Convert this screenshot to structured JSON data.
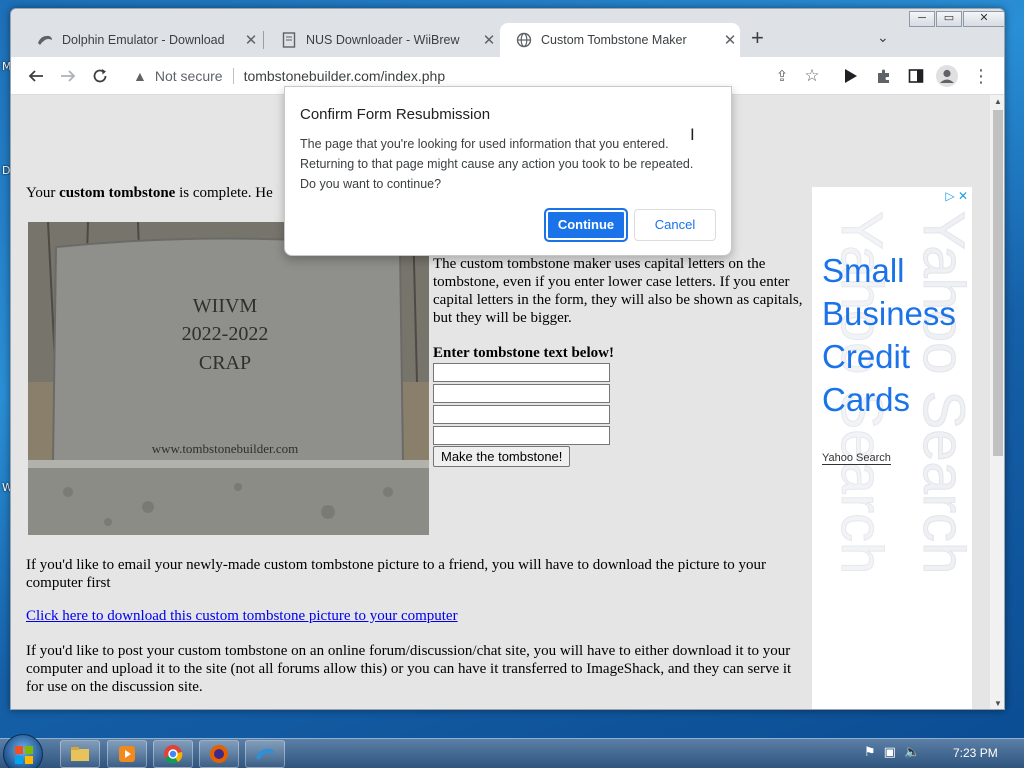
{
  "desktop": {
    "edge_labels": [
      "M",
      "D",
      "W"
    ]
  },
  "window": {
    "controls": [
      "minimize",
      "restore",
      "close"
    ]
  },
  "tabs": [
    {
      "title": "Dolphin Emulator - Download",
      "icon": "dolphin-icon",
      "active": false
    },
    {
      "title": "NUS Downloader - WiiBrew",
      "icon": "document-icon",
      "active": false
    },
    {
      "title": "Custom Tombstone Maker",
      "icon": "globe-icon",
      "active": true
    }
  ],
  "toolbar": {
    "security_label": "Not secure",
    "url": "tombstonebuilder.com/index.php"
  },
  "page": {
    "intro_prefix": "Your ",
    "intro_bold": "custom tombstone",
    "intro_suffix": " is complete. He",
    "tombstone_lines": [
      "WIIVM",
      "2022-2022",
      "CRAP"
    ],
    "tombstone_footer": "www.tombstonebuilder.com",
    "instructions": "The custom tombstone maker uses capital letters on the tombstone, even if you enter lower case letters. If you enter capital letters in the form, they will also be shown as capitals, but they will be bigger.",
    "form_label": "Enter tombstone text below!",
    "submit_label": "Make the tombstone!",
    "email_paragraph": "If you'd like to email your newly-made custom tombstone picture to a friend, you will have to download the picture to your computer first",
    "download_link": "Click here to download this custom tombstone picture to your computer",
    "forum_paragraph": "If you'd like to post your custom tombstone on an online forum/discussion/chat site, you will have to either download it to your computer and upload it to the site (not all forums allow this) or you can have it transferred to ImageShack, and they can serve it for use on the discussion site."
  },
  "ad": {
    "headline_lines": [
      "Small",
      "Business",
      "Credit",
      "Cards"
    ],
    "source": "Yahoo Search",
    "watermark": "Yahoo Search",
    "close_glyph": "✕",
    "info_glyph": "▷"
  },
  "dialog": {
    "title": "Confirm Form Resubmission",
    "body_lines": [
      "The page that you're looking for used information that you entered.",
      "Returning to that page might cause any action you took to be repeated.",
      "Do you want to continue?"
    ],
    "continue_label": "Continue",
    "cancel_label": "Cancel"
  },
  "taskbar": {
    "apps": [
      "explorer-icon",
      "media-player-icon",
      "chrome-icon",
      "firefox-icon",
      "dolphin-icon"
    ],
    "clock": "7:23 PM"
  },
  "colors": {
    "accent": "#1a73e8",
    "link": "#0000ee",
    "page_bg": "#e5e5e5",
    "ad_text": "#1a73e8"
  }
}
